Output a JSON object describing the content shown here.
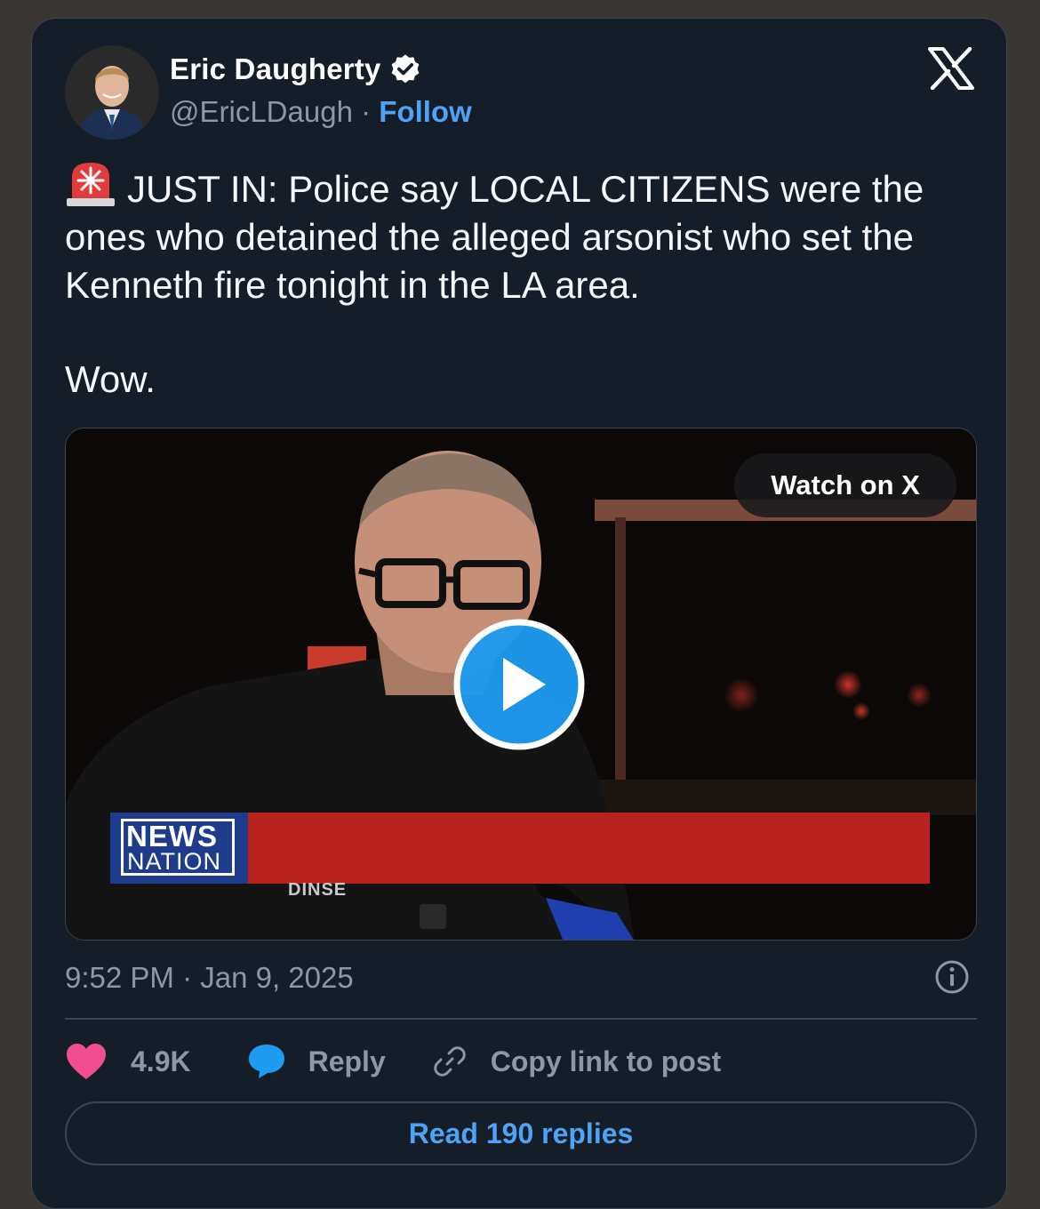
{
  "author": {
    "name": "Eric Daugherty",
    "handle": "@EricLDaugh",
    "separator": "·",
    "follow_label": "Follow",
    "verified_icon": "verified-badge-icon",
    "avatar_icon": "profile-photo"
  },
  "platform_icon": "x-logo-icon",
  "tweet": {
    "emoji": "🚨",
    "text": "JUST IN: Police say LOCAL CITIZENS were the ones who detained the alleged arsonist who set the Kenneth fire tonight in the LA area.",
    "text2": "Wow."
  },
  "media": {
    "watch_label": "Watch on X",
    "play_icon": "play-icon",
    "lower_third": {
      "logo_line1": "NEWS",
      "logo_line2": "NATION",
      "nametag": "DINSE"
    }
  },
  "timestamp": "9:52 PM · Jan 9, 2025",
  "info_icon": "info-icon",
  "actions": {
    "likes": "4.9K",
    "reply_label": "Reply",
    "copy_label": "Copy link to post",
    "read_replies_label": "Read 190 replies"
  },
  "colors": {
    "background": "#151d28",
    "accent": "#4da3f5",
    "heart": "#f04e8e",
    "muted_text": "#8b98a5",
    "news_red": "#b8231f",
    "news_blue": "#1f3b8c"
  }
}
